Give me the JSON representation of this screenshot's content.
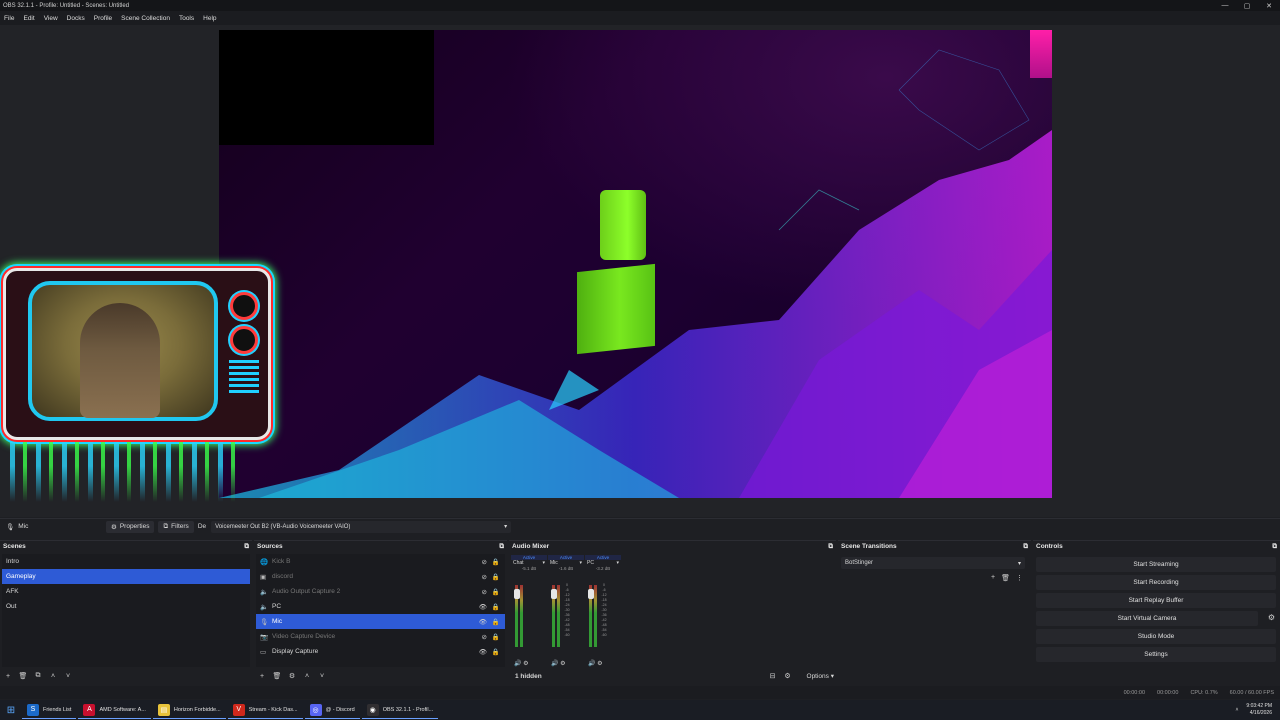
{
  "window": {
    "title": "OBS 32.1.1 - Profile: Untitled - Scenes: Untitled",
    "min": "—",
    "max": "▢",
    "close": "✕"
  },
  "menu": [
    "File",
    "Edit",
    "View",
    "Docks",
    "Profile",
    "Scene Collection",
    "Tools",
    "Help"
  ],
  "source_toolbar": {
    "selected_source": "Mic",
    "properties": "Properties",
    "filters": "Filters",
    "device_label": "De",
    "device_value": "Voicemeeter Out B2 (VB-Audio Voicemeeter VAIO)"
  },
  "scenes": {
    "title": "Scenes",
    "items": [
      "Intro",
      "Gameplay",
      "AFK",
      "Out"
    ],
    "selected": "Gameplay"
  },
  "sources": {
    "title": "Sources",
    "items": [
      {
        "name": "Kick B",
        "icon": "browser-icon",
        "visible": false
      },
      {
        "name": "discord",
        "icon": "image-icon",
        "visible": false
      },
      {
        "name": "Audio Output Capture 2",
        "icon": "speaker-icon",
        "visible": false
      },
      {
        "name": "PC",
        "icon": "speaker-icon",
        "visible": true
      },
      {
        "name": "Mic",
        "icon": "mic-icon",
        "visible": true,
        "selected": true
      },
      {
        "name": "Video Capture Device",
        "icon": "camera-icon",
        "visible": false
      },
      {
        "name": "Display Capture",
        "icon": "monitor-icon",
        "visible": true
      }
    ]
  },
  "mixer": {
    "title": "Audio Mixer",
    "channels": [
      {
        "active": "Active",
        "name": "Chat",
        "db": "-5.1 dB"
      },
      {
        "active": "Active",
        "name": "Mic",
        "db": "-1.6 dB"
      },
      {
        "active": "Active",
        "name": "PC",
        "db": "-3.2 dB"
      }
    ],
    "ticks": [
      "0",
      "-6",
      "-12",
      "-18",
      "-24",
      "-30",
      "-36",
      "-42",
      "-48",
      "-54",
      "-60"
    ],
    "hidden": "1 hidden",
    "options": "Options"
  },
  "transitions": {
    "title": "Scene Transitions",
    "selected": "BotStinger"
  },
  "controls": {
    "title": "Controls",
    "buttons": [
      "Start Streaming",
      "Start Recording",
      "Start Replay Buffer",
      "Start Virtual Camera",
      "Studio Mode",
      "Settings"
    ]
  },
  "status": {
    "stream_time": "00:00:00",
    "rec_time": "00:00:00",
    "cpu": "CPU: 0.7%",
    "fps": "60.00 / 60.00 FPS"
  },
  "taskbar": {
    "items": [
      {
        "label": "Friends List",
        "color": "#1b6ac9"
      },
      {
        "label": "AMD Software: A...",
        "color": "#c8102e"
      },
      {
        "label": "Horizon Forbidde...",
        "color": "#e8c33a"
      },
      {
        "label": "Stream - Kick Das...",
        "color": "#d0281c"
      },
      {
        "label": "@ - Discord",
        "color": "#5865f2"
      },
      {
        "label": "OBS 32.1.1 - Profil...",
        "color": "#302e31"
      }
    ],
    "time": "9:03:42 PM",
    "date": "4/16/2026"
  },
  "colors": {
    "selection": "#2e5bd6",
    "accent_blue": "#4a8bff"
  }
}
